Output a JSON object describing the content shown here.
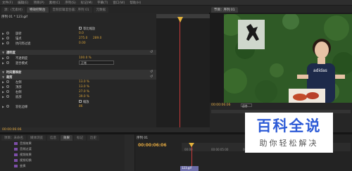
{
  "menu": [
    "文件(F)",
    "编辑(E)",
    "项目(P)",
    "素材(C)",
    "序列(S)",
    "标记(M)",
    "字幕(T)",
    "窗口(W)",
    "帮助(H)"
  ],
  "left_tabs": [
    "源：(无素材)",
    "特效控制台",
    "音频剪辑混合器：序列 01",
    "元数据"
  ],
  "right_tabs": [
    "节目：序列 01"
  ],
  "effect_controls": {
    "clip_name": "序列 01 * 123.gif",
    "rows": [
      {
        "type": "check",
        "label": "",
        "check_label": "等比缩放"
      },
      {
        "type": "prop",
        "label": "旋转",
        "value": "0.0"
      },
      {
        "type": "prop",
        "label": "锚点",
        "value": "275.0",
        "value2": "289.0"
      },
      {
        "type": "prop",
        "label": "抗闪烁过滤",
        "value": "0.00"
      },
      {
        "type": "header",
        "label": "透明度"
      },
      {
        "type": "prop",
        "label": "不透明度",
        "value": "100.0 %"
      },
      {
        "type": "select",
        "label": "混合模式",
        "value": "正常"
      },
      {
        "type": "header",
        "label": "时间重映射"
      },
      {
        "type": "header",
        "label": "裁剪"
      },
      {
        "type": "prop",
        "label": "左侧",
        "value": "13.0 %"
      },
      {
        "type": "prop",
        "label": "顶部",
        "value": "13.0 %"
      },
      {
        "type": "prop",
        "label": "右侧",
        "value": "27.0 %"
      },
      {
        "type": "prop",
        "label": "底部",
        "value": "39.0 %"
      },
      {
        "type": "check",
        "label": "",
        "check_label": "缩放"
      },
      {
        "type": "prop",
        "label": "羽化边缘",
        "value": "86"
      }
    ],
    "current_time": "00:00:06:06"
  },
  "project": {
    "tabs": [
      "项目：未命名",
      "媒体浏览",
      "信息",
      "效果",
      "标记",
      "历史"
    ],
    "items": [
      "音频效果",
      "音频过渡",
      "视频效果",
      "视频切换",
      "变换"
    ]
  },
  "sequence": {
    "tab": "序列 01",
    "timecode": "00:00:06:06",
    "ruler": [
      "00:00",
      "00:00:05:00",
      "00:00:10:00",
      "00:00:15:00",
      "00:00:20:00"
    ],
    "clip_label": "123.gif"
  },
  "program": {
    "timecode": "00:00:06:06",
    "fit": "适合",
    "shirt_text": "adidas"
  },
  "watermark": {
    "title": "百科全说",
    "subtitle": "助你轻松解决"
  },
  "colors": {
    "timecode": "#e0a740",
    "playhead": "#c63a3a",
    "brand_blue": "#2d5bd6"
  }
}
